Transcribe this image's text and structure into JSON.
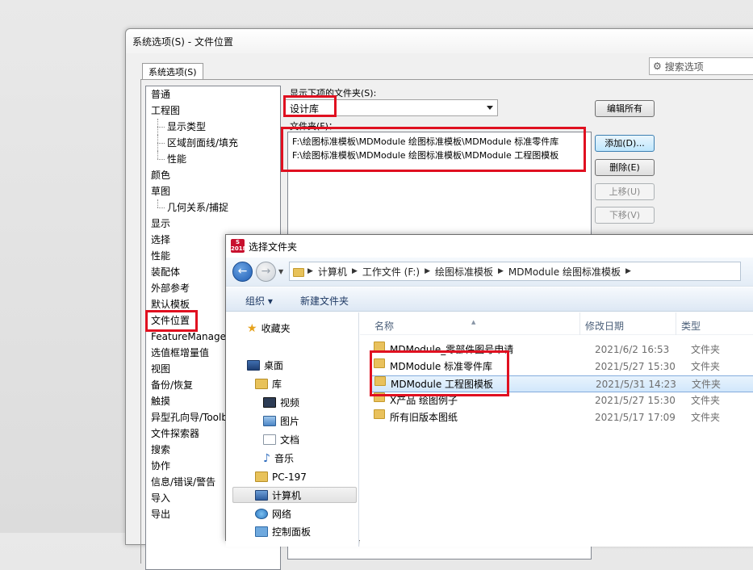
{
  "main_dialog": {
    "title": "系统选项(S) - 文件位置",
    "tab": "系统选项(S)",
    "search_placeholder": "搜索选项",
    "tree": [
      {
        "label": "普通",
        "level": 0
      },
      {
        "label": "工程图",
        "level": 0
      },
      {
        "label": "显示类型",
        "level": 1
      },
      {
        "label": "区域剖面线/填充",
        "level": 1
      },
      {
        "label": "性能",
        "level": 1
      },
      {
        "label": "颜色",
        "level": 0
      },
      {
        "label": "草图",
        "level": 0
      },
      {
        "label": "几何关系/捕捉",
        "level": 1
      },
      {
        "label": "显示",
        "level": 0
      },
      {
        "label": "选择",
        "level": 0
      },
      {
        "label": "性能",
        "level": 0
      },
      {
        "label": "装配体",
        "level": 0
      },
      {
        "label": "外部参考",
        "level": 0
      },
      {
        "label": "默认模板",
        "level": 0
      },
      {
        "label": "文件位置",
        "level": 0
      },
      {
        "label": "FeatureManager",
        "level": 0
      },
      {
        "label": "选值框增量值",
        "level": 0
      },
      {
        "label": "视图",
        "level": 0
      },
      {
        "label": "备份/恢复",
        "level": 0
      },
      {
        "label": "触摸",
        "level": 0
      },
      {
        "label": "异型孔向导/Toolbox",
        "level": 0
      },
      {
        "label": "文件探索器",
        "level": 0
      },
      {
        "label": "搜索",
        "level": 0
      },
      {
        "label": "协作",
        "level": 0
      },
      {
        "label": "信息/错误/警告",
        "level": 0
      },
      {
        "label": "导入",
        "level": 0
      },
      {
        "label": "导出",
        "level": 0
      }
    ],
    "show_folders_label": "显示下项的文件夹(S):",
    "show_folders_value": "设计库",
    "folders_label": "文件夹(F)：",
    "folders": [
      "F:\\绘图标准模板\\MDModule 绘图标准模板\\MDModule 标准零件库",
      "F:\\绘图标准模板\\MDModule 绘图标准模板\\MDModule 工程图模板"
    ],
    "buttons": {
      "edit_all": "编辑所有",
      "add": "添加(D)...",
      "delete": "删除(E)",
      "move_up": "上移(U)",
      "move_down": "下移(V)"
    }
  },
  "picker": {
    "title": "选择文件夹",
    "app_icon_text": "S\n2018",
    "breadcrumb": [
      "计算机",
      "工作文件 (F:)",
      "绘图标准模板",
      "MDModule 绘图标准模板"
    ],
    "commands": {
      "organize": "组织 ▾",
      "new_folder": "新建文件夹"
    },
    "nav": [
      {
        "label": "收藏夹",
        "icon": "star-icon"
      },
      {
        "label": "桌面",
        "icon": "desktop-icon"
      },
      {
        "label": "库",
        "icon": "library-icon"
      },
      {
        "label": "视频",
        "icon": "video-icon"
      },
      {
        "label": "图片",
        "icon": "picture-icon"
      },
      {
        "label": "文档",
        "icon": "document-icon"
      },
      {
        "label": "音乐",
        "icon": "music-icon"
      },
      {
        "label": "PC-197",
        "icon": "user-folder-icon"
      },
      {
        "label": "计算机",
        "icon": "computer-icon"
      },
      {
        "label": "网络",
        "icon": "network-icon"
      },
      {
        "label": "控制面板",
        "icon": "control-panel-icon"
      }
    ],
    "columns": {
      "name": "名称",
      "date": "修改日期",
      "type": "类型"
    },
    "rows": [
      {
        "name": "MDModule_零部件图号申请",
        "date": "2021/6/2 16:53",
        "type": "文件夹"
      },
      {
        "name": "MDModule 标准零件库",
        "date": "2021/5/27 15:30",
        "type": "文件夹"
      },
      {
        "name": "MDModule 工程图模板",
        "date": "2021/5/31 14:23",
        "type": "文件夹"
      },
      {
        "name": "X产品 绘图例子",
        "date": "2021/5/27 15:30",
        "type": "文件夹"
      },
      {
        "name": "所有旧版本图纸",
        "date": "2021/5/17 17:09",
        "type": "文件夹"
      }
    ]
  },
  "colors": {
    "highlight": "#e01020",
    "selection": "#d1e7fb"
  }
}
